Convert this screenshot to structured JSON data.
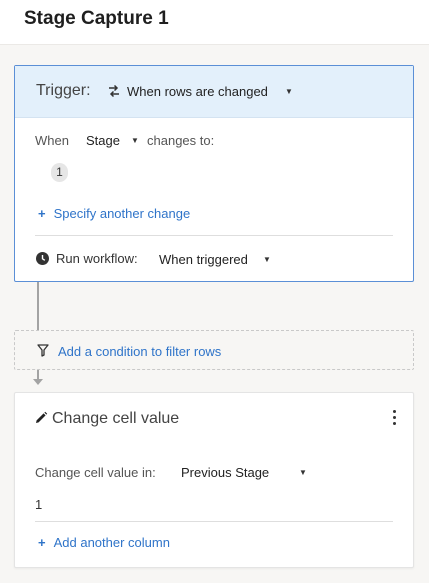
{
  "header": {
    "title": "Stage Capture 1"
  },
  "trigger": {
    "label": "Trigger:",
    "icon": "swap-arrows-icon",
    "value": "When rows are changed",
    "when_label": "When",
    "column": "Stage",
    "changes_to": "changes to:",
    "chip_value": "1",
    "specify_link": "Specify another change",
    "run_label": "Run workflow:",
    "run_value": "When triggered"
  },
  "filter": {
    "label": "Add a condition to filter rows"
  },
  "action": {
    "title": "Change cell value",
    "cell_label": "Change cell value in:",
    "column": "Previous Stage",
    "value": "1",
    "add_link": "Add another column"
  },
  "colors": {
    "accent": "#2f74c9",
    "trigger_header_bg": "#e3f0fb",
    "trigger_border": "#5b8fd6",
    "page_bg": "#f7f6f4"
  }
}
